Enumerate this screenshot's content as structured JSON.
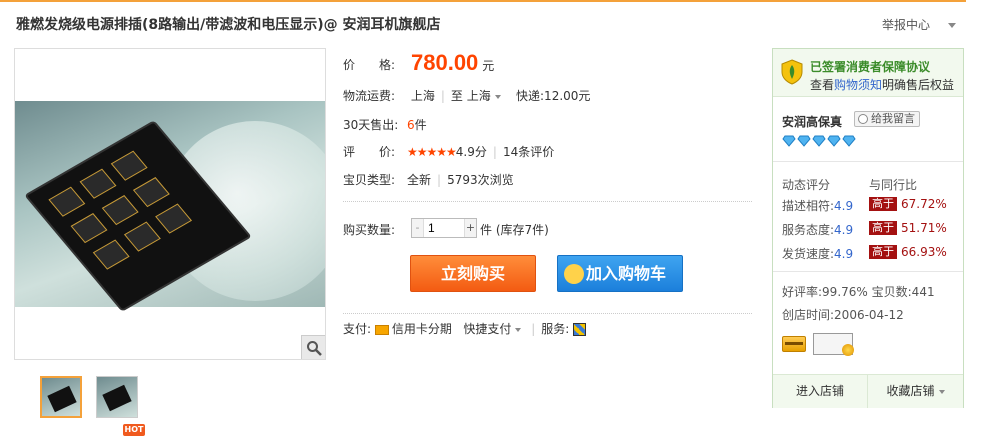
{
  "header": {
    "title": "雅燃发烧级电源排插(8路输出/带滤波和电压显示)@ 安润耳机旗舰店",
    "report_label": "举报中心"
  },
  "price": {
    "label": "价　　格:",
    "value": "780.00",
    "unit": "元"
  },
  "shipping": {
    "label": "物流运费:",
    "from": "上海",
    "to_prefix": "至",
    "to": "上海",
    "method": "快递:12.00元"
  },
  "sales": {
    "label": "30天售出:",
    "count": "6",
    "unit": "件"
  },
  "rating": {
    "label": "评　　价:",
    "stars": "★★★★★",
    "score": "4.9分",
    "reviews": "14条评价"
  },
  "item_type": {
    "label": "宝贝类型:",
    "value": "全新",
    "views": "5793次浏览"
  },
  "quantity": {
    "label": "购买数量:",
    "minus": "-",
    "plus": "+",
    "value": "1",
    "stock": "件 (库存7件)"
  },
  "buttons": {
    "buy": "立刻购买",
    "cart": "加入购物车"
  },
  "payment": {
    "label": "支付:",
    "card": "信用卡分期",
    "quick": "快捷支付",
    "service_label": "服务:"
  },
  "gallery": {
    "hot_badge": "HOT"
  },
  "shop": {
    "guarantee_line1": "已签署消费者保障协议",
    "guarantee_prefix": "查看",
    "guarantee_link": "购物须知",
    "guarantee_suffix": "明确售后权益",
    "name": "安润高保真",
    "message_button": "给我留言",
    "dsr_header": "动态评分",
    "compare_header": "与同行比",
    "dsr": [
      {
        "label": "描述相符:",
        "score": "4.9",
        "tag": "高于",
        "pct": "67.72%"
      },
      {
        "label": "服务态度:",
        "score": "4.9",
        "tag": "高于",
        "pct": "51.71%"
      },
      {
        "label": "发货速度:",
        "score": "4.9",
        "tag": "高于",
        "pct": "66.93%"
      }
    ],
    "good_rate": "好评率:99.76%",
    "items": "宝贝数:441",
    "created": "创店时间:2006-04-12",
    "enter_shop": "进入店铺",
    "favorite_shop": "收藏店铺"
  }
}
